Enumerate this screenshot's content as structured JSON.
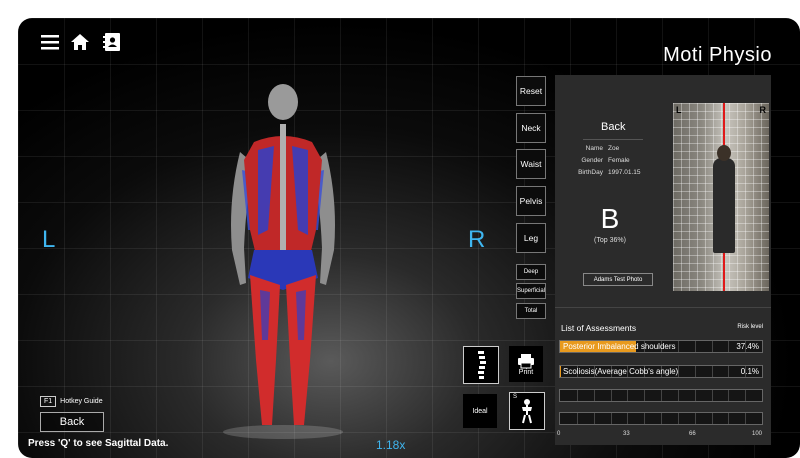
{
  "brand": "Moti Physio",
  "toolbar": {
    "menu_icon": "menu-icon",
    "home_icon": "home-icon",
    "contacts_icon": "contacts-icon"
  },
  "sides": {
    "left": "L",
    "right": "R"
  },
  "zoom_level": "1.18x",
  "hint": "Press 'Q' to see Sagittal Data.",
  "hotkey": {
    "key": "F1",
    "label": "Hotkey Guide"
  },
  "back_label": "Back",
  "view_buttons": [
    "Reset",
    "Neck",
    "Waist",
    "Pelvis",
    "Leg"
  ],
  "layer_buttons": [
    "Deep",
    "Superficial",
    "Total"
  ],
  "profile": {
    "back_label": "Back",
    "fields": [
      {
        "label": "Name",
        "value": "Zoe"
      },
      {
        "label": "Gender",
        "value": "Female"
      },
      {
        "label": "BirthDay",
        "value": "1997.01.15"
      }
    ],
    "grade": "B",
    "grade_note": "(Top 36%)",
    "photo_button": "Adams Test Photo"
  },
  "photo": {
    "left": "L",
    "right": "R"
  },
  "assessments": {
    "title": "List of Assessments",
    "risk_header": "Risk level",
    "rows": [
      {
        "label": "Posterior Imbalanced shoulders",
        "value": "37.4%",
        "level": 0.374,
        "color": "#e89a1e"
      },
      {
        "label": "Scoliosis(Average Cobb's angle)",
        "value": "0.1%",
        "level": 0.001,
        "color": "#e89a1e"
      },
      {
        "label": "",
        "value": "",
        "level": 0
      },
      {
        "label": "",
        "value": "",
        "level": 0
      }
    ],
    "scale": [
      "0",
      "33",
      "66",
      "100"
    ]
  },
  "tools": {
    "print_label": "Print",
    "ideal_label": "Ideal",
    "s_label": "S"
  }
}
